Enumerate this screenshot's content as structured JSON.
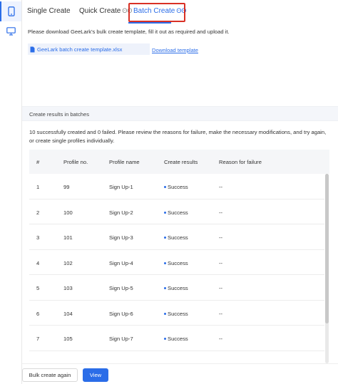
{
  "tabs": {
    "single": "Single Create",
    "quick": "Quick Create",
    "batch": "Batch Create",
    "suffix_glyph": "ʘʘ"
  },
  "instruction": "Please download GeeLark's bulk create template, fill it out as required and upload it.",
  "template": {
    "file_name": "GeeLark batch create template.xlsx",
    "download_label": "Download template"
  },
  "results": {
    "section_title": "Create results in batches",
    "message": "10 successfully created and 0 failed. Please review the reasons for failure, make the necessary modifications, and try again, or create single profiles individually."
  },
  "table": {
    "headers": [
      "#",
      "Profile no.",
      "Profile name",
      "Create results",
      "Reason for failure"
    ],
    "rows": [
      {
        "index": "1",
        "profile_no": "99",
        "profile_name": "Sign Up-1",
        "result": "Success",
        "reason": "--"
      },
      {
        "index": "2",
        "profile_no": "100",
        "profile_name": "Sign Up-2",
        "result": "Success",
        "reason": "--"
      },
      {
        "index": "3",
        "profile_no": "101",
        "profile_name": "Sign Up-3",
        "result": "Success",
        "reason": "--"
      },
      {
        "index": "4",
        "profile_no": "102",
        "profile_name": "Sign Up-4",
        "result": "Success",
        "reason": "--"
      },
      {
        "index": "5",
        "profile_no": "103",
        "profile_name": "Sign Up-5",
        "result": "Success",
        "reason": "--"
      },
      {
        "index": "6",
        "profile_no": "104",
        "profile_name": "Sign Up-6",
        "result": "Success",
        "reason": "--"
      },
      {
        "index": "7",
        "profile_no": "105",
        "profile_name": "Sign Up-7",
        "result": "Success",
        "reason": "--"
      }
    ]
  },
  "footer": {
    "bulk_again_label": "Bulk create again",
    "view_label": "View"
  },
  "icons": {
    "rail_phone": "phone-icon",
    "rail_desktop": "desktop-icon",
    "file": "file-icon"
  },
  "colors": {
    "accent": "#2b6de8",
    "highlight": "#d93025"
  }
}
